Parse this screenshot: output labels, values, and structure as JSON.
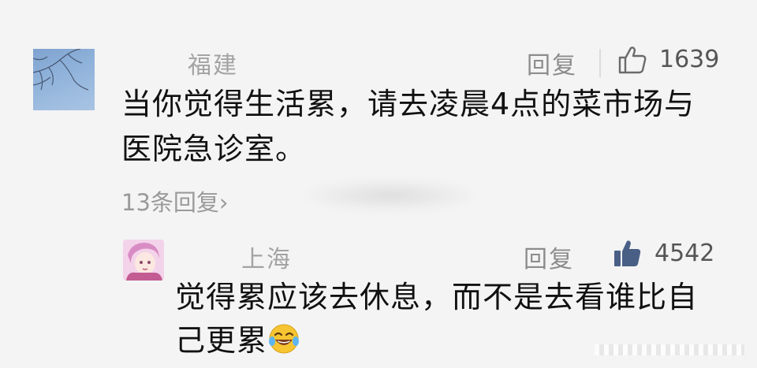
{
  "comment": {
    "username": "福建",
    "reply_label": "回复",
    "like_count": "1639",
    "text_line1": "当你觉得生活累，请去凌晨4点的菜市场与",
    "text_line2": "医院急诊室。",
    "more_replies": "13条回复›"
  },
  "reply": {
    "username": "上海",
    "reply_label": "回复",
    "like_count": "4542",
    "text_line1": "觉得累应该去休息，而不是去看谁比自",
    "text_line2": "己更累",
    "emoji": "laughing-tears-emoji"
  },
  "colors": {
    "background": "#f4f4f4",
    "username": "#a3a3a3",
    "liked_thumb": "#4a5f86"
  }
}
